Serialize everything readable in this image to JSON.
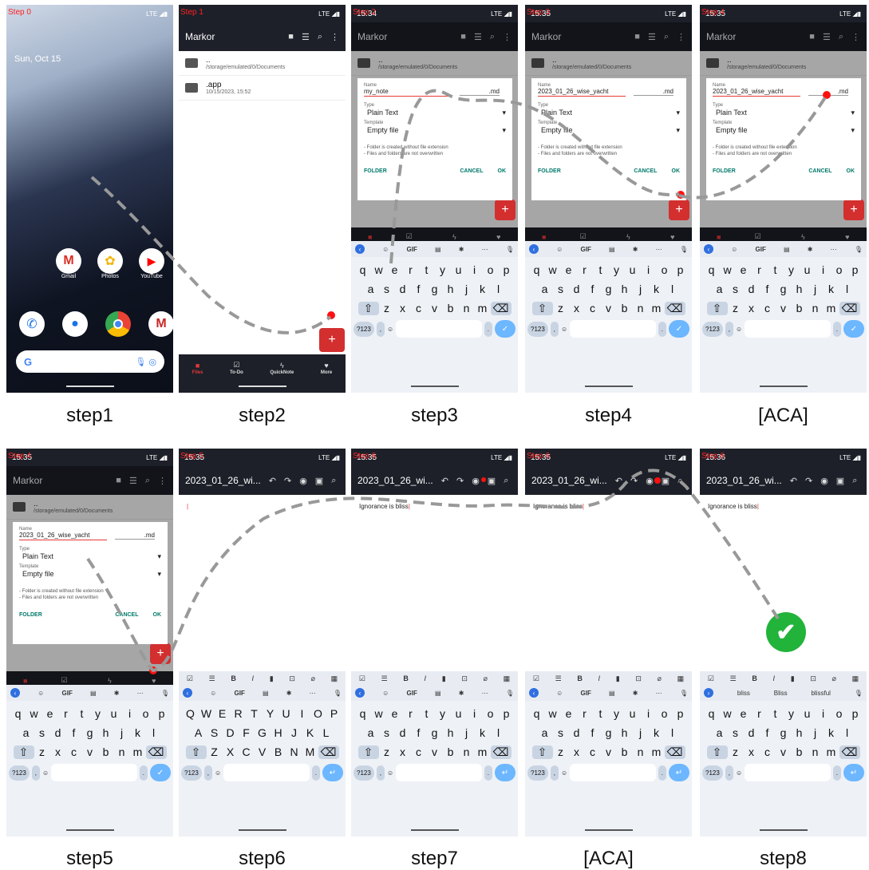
{
  "labels": [
    "step1",
    "step2",
    "step3",
    "step4",
    "[ACA]",
    "step5",
    "step6",
    "step7",
    "[ACA]",
    "step8"
  ],
  "tags": [
    "Step 0",
    "Step 1",
    "Step 2",
    "Step 3",
    "Step 4",
    "Step 4",
    "Step 5",
    "Step 6",
    "Step 6"
  ],
  "times": [
    "15:34",
    "15:34",
    "15:34",
    "15:35",
    "15:35",
    "15:35",
    "15:35",
    "15:35",
    "15:36"
  ],
  "net": "LTE",
  "home": {
    "date": "Sun, Oct 15",
    "apps_row1": [
      "Gmail",
      "Photos",
      "YouTube"
    ]
  },
  "app": {
    "title": "Markor",
    "folder_up": "..",
    "folder_path": "/storage/emulated/0/Documents",
    "app_folder": ".app",
    "app_folder_date": "10/15/2023, 15:52"
  },
  "nav": [
    "Files",
    "To-Do",
    "QuickNote",
    "More"
  ],
  "dialog": {
    "name_label": "Name",
    "type_label": "Type",
    "template_label": "Template",
    "name_initial": "my_note",
    "name_final": "2023_01_26_wise_yacht",
    "ext": ".md",
    "type": "Plain Text",
    "template": "Empty file",
    "note1": "- Folder is created without file extension",
    "note2": "- Files and folders are not overwritten",
    "folder": "FOLDER",
    "cancel": "CANCEL",
    "ok": "OK"
  },
  "keyboard": {
    "row1": [
      "q",
      "w",
      "e",
      "r",
      "t",
      "y",
      "u",
      "i",
      "o",
      "p"
    ],
    "row2": [
      "a",
      "s",
      "d",
      "f",
      "g",
      "h",
      "j",
      "k",
      "l"
    ],
    "row3": [
      "z",
      "x",
      "c",
      "v",
      "b",
      "n",
      "m"
    ],
    "row1u": [
      "Q",
      "W",
      "E",
      "R",
      "T",
      "Y",
      "U",
      "I",
      "O",
      "P"
    ],
    "row2u": [
      "A",
      "S",
      "D",
      "F",
      "G",
      "H",
      "J",
      "K",
      "L"
    ],
    "row3u": [
      "Z",
      "X",
      "C",
      "V",
      "B",
      "N",
      "M"
    ],
    "sym": "?123",
    "gif": "GIF",
    "suggestions": [
      "bliss",
      "Bliss",
      "blissful"
    ]
  },
  "editor": {
    "title": "2023_01_26_wi...",
    "text": "Ignorance is bliss"
  }
}
